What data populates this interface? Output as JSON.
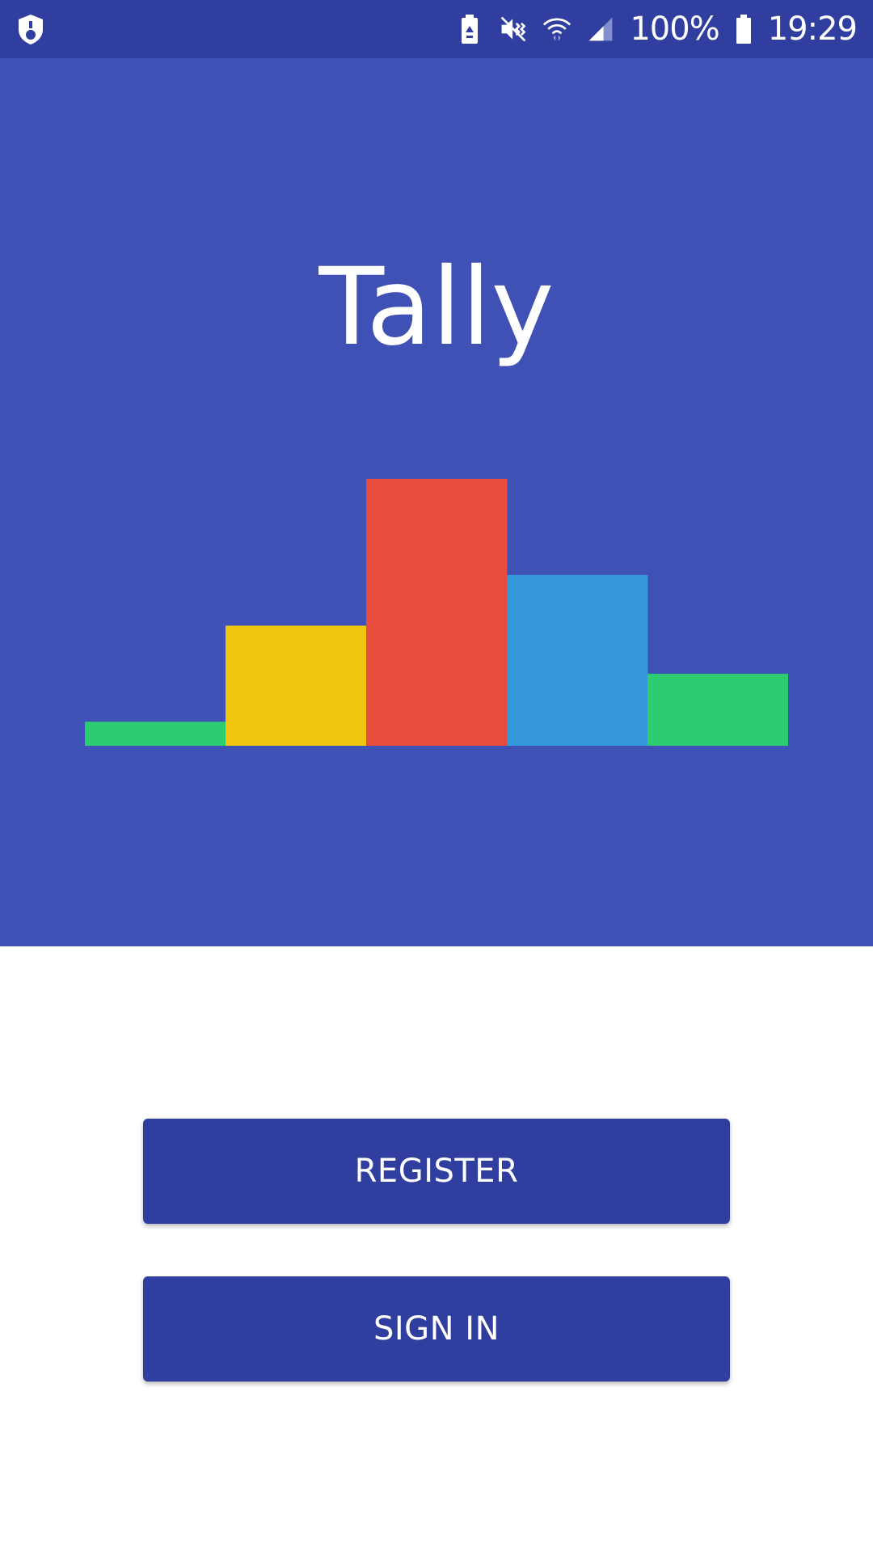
{
  "status_bar": {
    "background": "#303F9F",
    "left_icons": [
      "shield-icon"
    ],
    "right_icons": [
      "battery-saver-icon",
      "vibrate-mute-icon",
      "wifi-icon",
      "cellular-signal-icon",
      "battery-icon"
    ],
    "battery_text": "100%",
    "time": "19:29"
  },
  "hero": {
    "background": "#3F51B5",
    "app_title": "Tally",
    "logo_bars": [
      {
        "value": 0.09,
        "color": "#2ECC71"
      },
      {
        "value": 0.45,
        "color": "#F1C40F"
      },
      {
        "value": 1.0,
        "color": "#E74C3C"
      },
      {
        "value": 0.64,
        "color": "#3498DB"
      },
      {
        "value": 0.27,
        "color": "#2ECC71"
      }
    ]
  },
  "actions": {
    "register_label": "REGISTER",
    "signin_label": "SIGN IN",
    "button_color": "#303F9F"
  }
}
